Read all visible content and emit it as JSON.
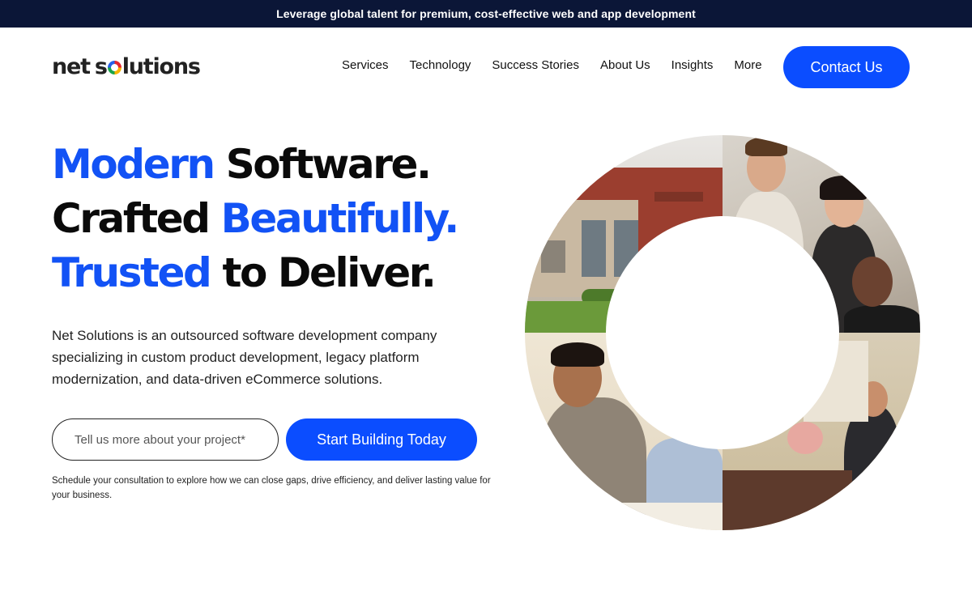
{
  "announcement": "Leverage global talent for premium, cost-effective web and app development",
  "logo": {
    "part1": "net",
    "part2_before": "s",
    "part2_after": "lutions"
  },
  "nav": {
    "items": [
      "Services",
      "Technology",
      "Success Stories",
      "About Us",
      "Insights",
      "More"
    ]
  },
  "contact_button": "Contact Us",
  "hero": {
    "line1_blue": "Modern",
    "line1_black": "Software.",
    "line2_black": "Crafted",
    "line2_blue": "Beautifully.",
    "line3_blue": "Trusted",
    "line3_black": "to Deliver.",
    "description": "Net Solutions is an outsourced software development company specializing in custom product development, legacy platform modernization, and data-driven eCommerce solutions.",
    "input_placeholder": "Tell us more about your project*",
    "cta_button": "Start Building Today",
    "note": "Schedule your consultation to explore how we can close gaps, drive efficiency, and deliver lasting value for your business."
  },
  "colors": {
    "brand_blue": "#0b4dff",
    "headline_blue": "#1252f5",
    "topbar": "#0b1637"
  }
}
